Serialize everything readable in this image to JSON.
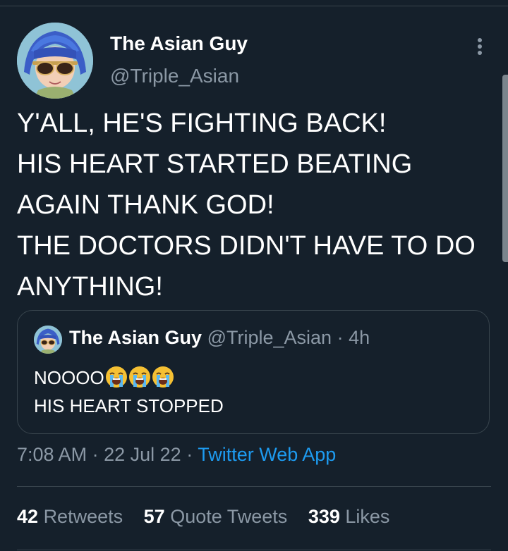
{
  "author": {
    "display_name": "The Asian Guy",
    "handle": "@Triple_Asian"
  },
  "tweet": {
    "text": "Y'ALL, HE'S FIGHTING BACK!\nHIS HEART STARTED BEATING AGAIN THANK GOD!\nTHE DOCTORS DIDN'T HAVE TO DO ANYTHING!"
  },
  "quoted": {
    "display_name": "The Asian Guy",
    "handle": "@Triple_Asian",
    "separator": "·",
    "age": "4h",
    "line1": "NOOOO",
    "emoji": "loudly-crying-face",
    "emoji_count": 3,
    "line2": "HIS HEART STOPPED"
  },
  "meta": {
    "time": "7:08 AM",
    "separator": "·",
    "date": "22 Jul 22",
    "source": "Twitter Web App"
  },
  "stats": {
    "retweets_count": "42",
    "retweets_label": "Retweets",
    "quotes_count": "57",
    "quotes_label": "Quote Tweets",
    "likes_count": "339",
    "likes_label": "Likes"
  },
  "colors": {
    "background": "#15202b",
    "secondary_text": "#8b98a5",
    "accent": "#1d9bf0",
    "border": "#38444d"
  }
}
